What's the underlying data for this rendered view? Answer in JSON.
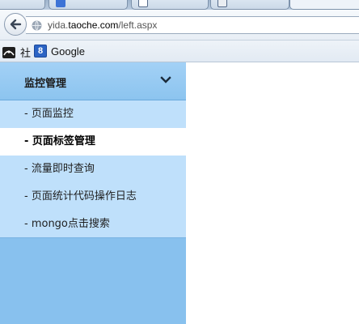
{
  "browser": {
    "address": {
      "prefix": "yida.",
      "domain": "taoche.com",
      "path": "/left.aspx"
    },
    "bookmarks": [
      {
        "label": "社",
        "icon": "dark-app-icon"
      },
      {
        "label": "Google",
        "icon": "google-icon"
      }
    ],
    "colors": {
      "google_icon_bg": "#2c64c4"
    }
  },
  "sidebar": {
    "section_title": "监控管理",
    "items": [
      {
        "label": "- 页面监控",
        "active": false
      },
      {
        "label": "- 页面标签管理",
        "active": true
      },
      {
        "label": "- 流量即时查询",
        "active": false
      },
      {
        "label": "- 页面统计代码操作日志",
        "active": false
      },
      {
        "label": "- mongo点击搜索",
        "active": false
      }
    ],
    "colors": {
      "panel_bg": "#88c1ee",
      "item_bg": "#bfe0fb",
      "active_bg": "#ffffff"
    }
  }
}
